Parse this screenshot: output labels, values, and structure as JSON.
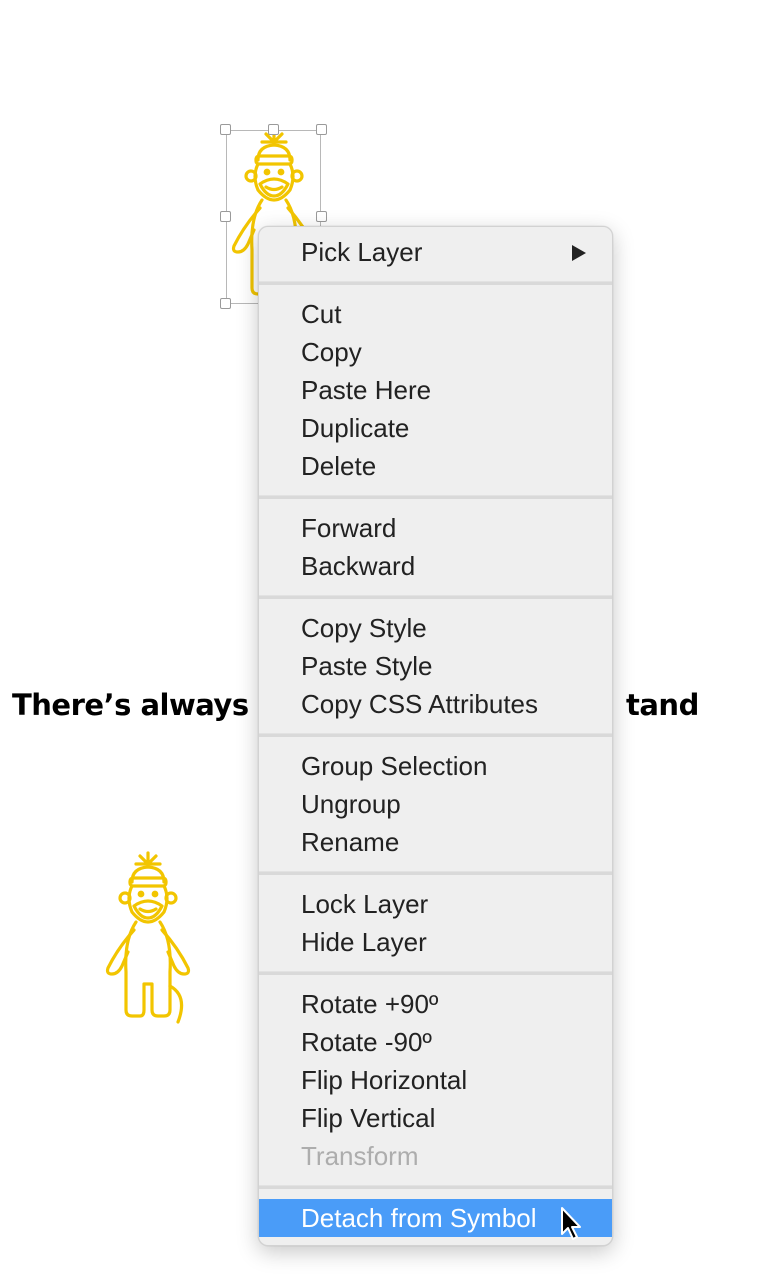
{
  "canvas": {
    "text_visible_left": "There’s always r",
    "text_visible_right": "tand"
  },
  "colors": {
    "monkey_stroke": "#f2c500",
    "menu_highlight": "#4a9cf8",
    "menu_background": "#efefef"
  },
  "menu": {
    "groups": [
      [
        {
          "label": "Pick Layer",
          "submenu": true
        }
      ],
      [
        {
          "label": "Cut"
        },
        {
          "label": "Copy"
        },
        {
          "label": "Paste Here"
        },
        {
          "label": "Duplicate"
        },
        {
          "label": "Delete"
        }
      ],
      [
        {
          "label": "Forward"
        },
        {
          "label": "Backward"
        }
      ],
      [
        {
          "label": "Copy Style"
        },
        {
          "label": "Paste Style"
        },
        {
          "label": "Copy CSS Attributes"
        }
      ],
      [
        {
          "label": "Group Selection"
        },
        {
          "label": "Ungroup"
        },
        {
          "label": "Rename"
        }
      ],
      [
        {
          "label": "Lock Layer"
        },
        {
          "label": "Hide Layer"
        }
      ],
      [
        {
          "label": "Rotate +90º"
        },
        {
          "label": "Rotate -90º"
        },
        {
          "label": "Flip Horizontal"
        },
        {
          "label": "Flip Vertical"
        },
        {
          "label": "Transform",
          "disabled": true
        }
      ],
      [
        {
          "label": "Detach from Symbol",
          "highlighted": true
        }
      ]
    ]
  }
}
